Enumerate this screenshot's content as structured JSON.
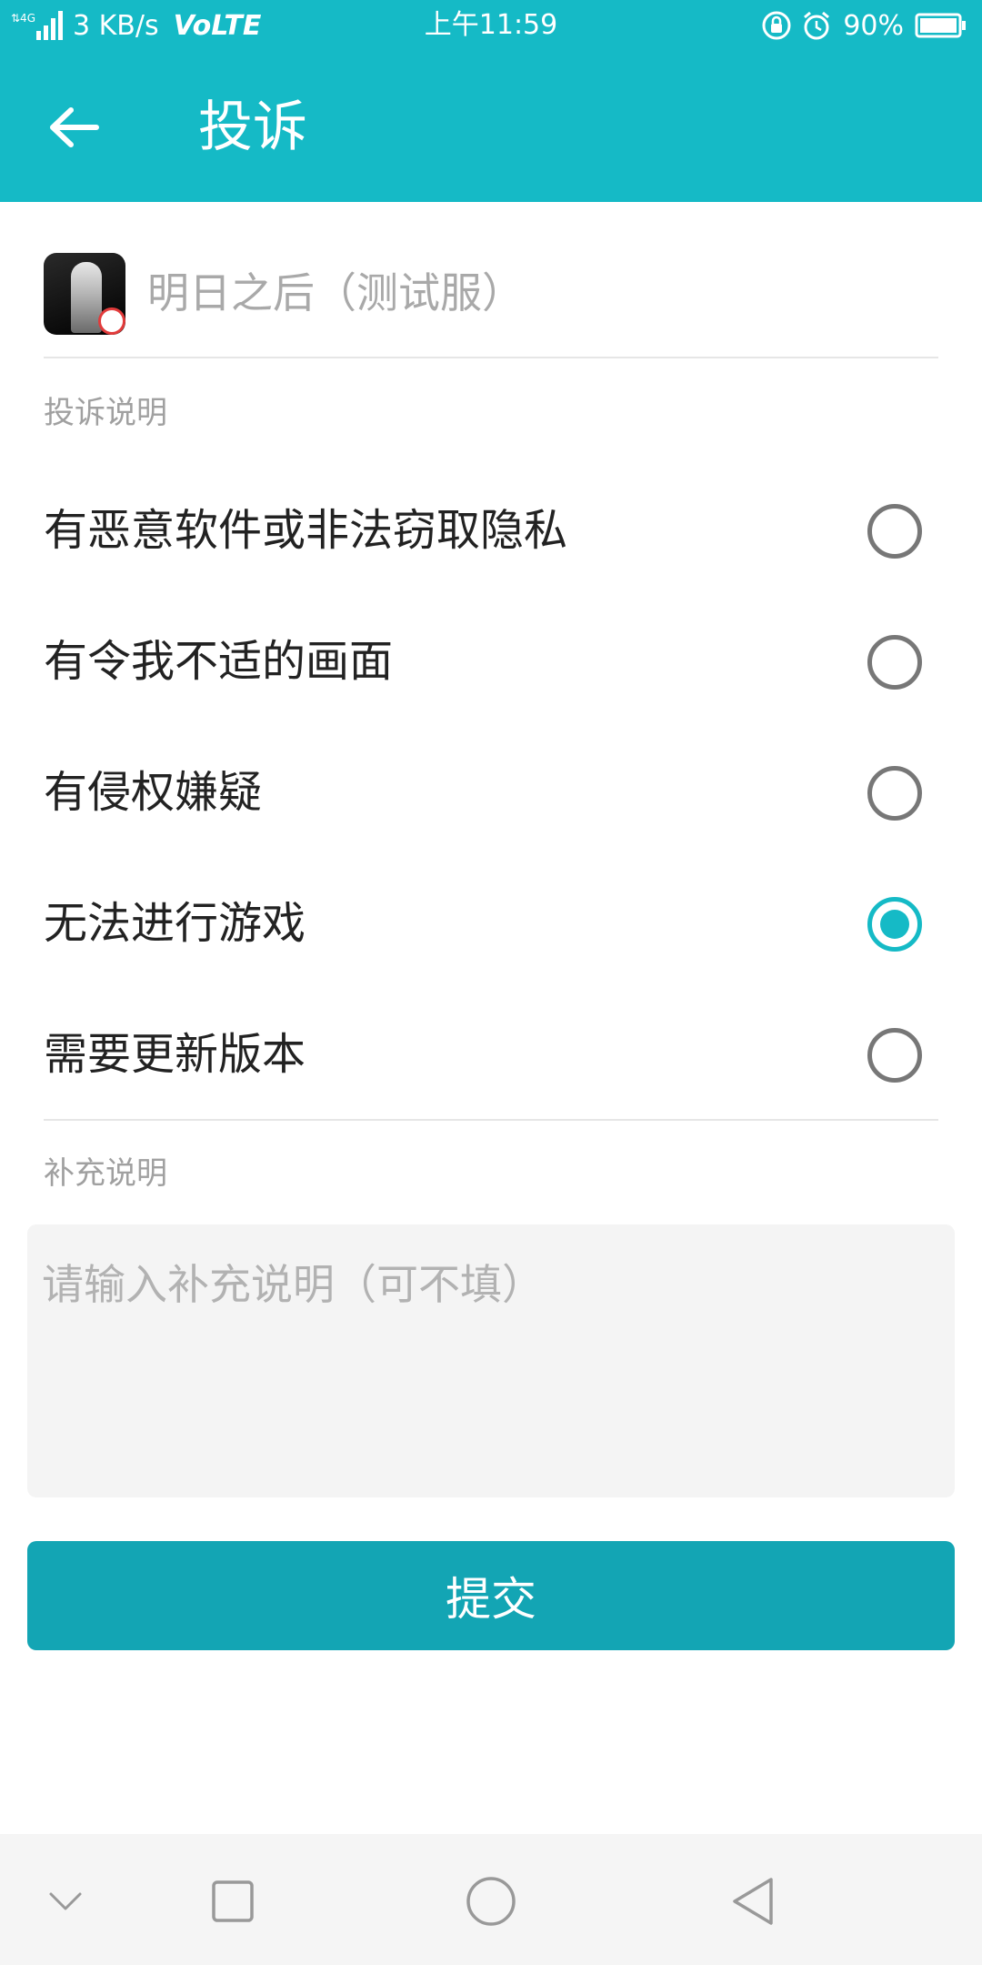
{
  "status_bar": {
    "network": "4G",
    "speed": "3 KB/s",
    "volte": "VoLTE",
    "time": "上午11:59",
    "battery": "90%",
    "icons": [
      "signal-icon",
      "lock-rotation-icon",
      "alarm-icon",
      "battery-icon"
    ]
  },
  "app_bar": {
    "title": "投诉",
    "back_icon": "arrow-left-icon"
  },
  "game": {
    "name": "明日之后（测试服）",
    "icon": "game-app-icon"
  },
  "complaint": {
    "section_label": "投诉说明",
    "options": [
      {
        "label": "有恶意软件或非法窃取隐私",
        "selected": false
      },
      {
        "label": "有令我不适的画面",
        "selected": false
      },
      {
        "label": "有侵权嫌疑",
        "selected": false
      },
      {
        "label": "无法进行游戏",
        "selected": true
      },
      {
        "label": "需要更新版本",
        "selected": false
      }
    ]
  },
  "extra": {
    "section_label": "补充说明",
    "placeholder": "请输入补充说明（可不填）",
    "value": ""
  },
  "submit_label": "提交",
  "nav_bar": {
    "icons": [
      "hide-keyboard-icon",
      "recent-apps-icon",
      "home-icon",
      "back-icon"
    ]
  },
  "colors": {
    "primary": "#15bac6",
    "button": "#13a5b4"
  }
}
